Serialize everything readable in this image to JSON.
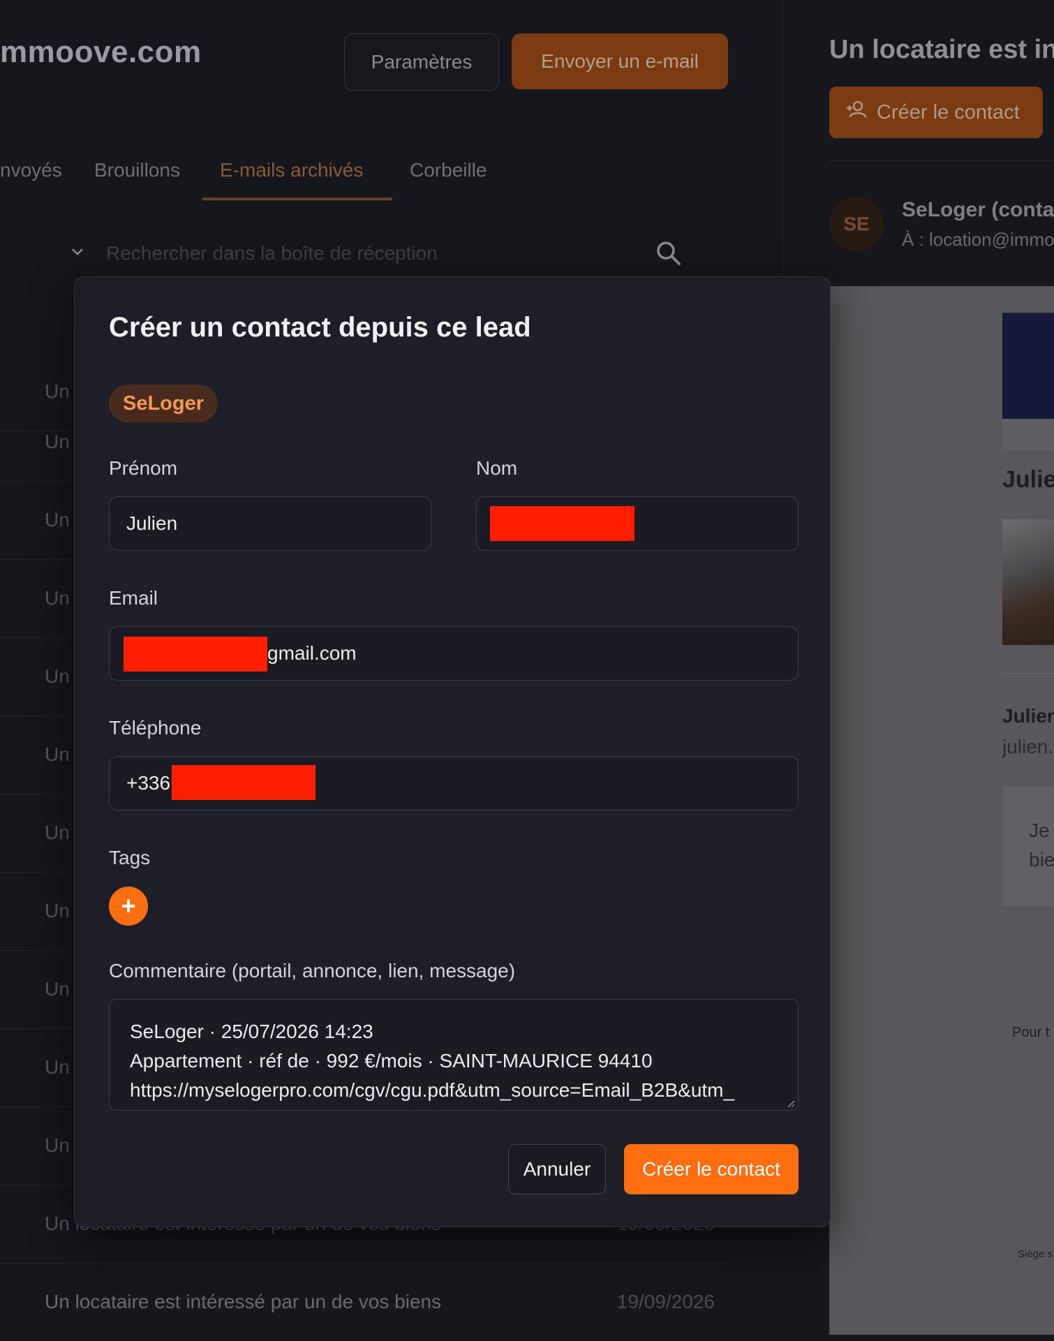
{
  "app": {
    "brand": "mmoove.com"
  },
  "header": {
    "settings_label": "Paramètres",
    "send_email_label": "Envoyer un e-mail"
  },
  "tabs": [
    {
      "label": "nvoyés",
      "active": false
    },
    {
      "label": "Brouillons",
      "active": false
    },
    {
      "label": "E-mails archivés",
      "active": true
    },
    {
      "label": "Corbeille",
      "active": false
    }
  ],
  "search": {
    "placeholder": "Rechercher dans la boîte de réception"
  },
  "mail_list": [
    {
      "subject": "Un",
      "date": ""
    },
    {
      "subject": "Un",
      "date": ""
    },
    {
      "subject": "Un",
      "date": ""
    },
    {
      "subject": "Un",
      "date": ""
    },
    {
      "subject": "Un",
      "date": ""
    },
    {
      "subject": "Un",
      "date": ""
    },
    {
      "subject": "Un",
      "date": ""
    },
    {
      "subject": "Un",
      "date": ""
    },
    {
      "subject": "Un",
      "date": ""
    },
    {
      "subject": "Un",
      "date": ""
    },
    {
      "subject": "Un",
      "date": ""
    },
    {
      "subject": "Un locataire est intéressé par un de vos biens",
      "date": "19/09/2026"
    },
    {
      "subject": "Un locataire est intéressé par un de vos biens",
      "date": "19/09/2026"
    }
  ],
  "reading_pane": {
    "title": "Un locataire est int",
    "create_contact_label": "Créer le contact",
    "avatar_initials": "SE",
    "sender": "SeLoger (contac",
    "to": "À : location@immoo",
    "body_heading": "Julie",
    "body_name": "Julien",
    "body_email": "julien.",
    "quote_line1": "Je",
    "quote_line2": "bie",
    "footer_text": "Pour t",
    "legal_text": "Siège s"
  },
  "modal": {
    "title": "Créer un contact depuis ce lead",
    "source_chip": "SeLoger",
    "first_name_label": "Prénom",
    "first_name_value": "Julien",
    "last_name_label": "Nom",
    "email_label": "Email",
    "email_value_suffix": "gmail.com",
    "phone_label": "Téléphone",
    "phone_value_prefix": "+336",
    "tags_label": "Tags",
    "add_tag_symbol": "+",
    "comment_label": "Commentaire (portail, annonce, lien, message)",
    "comment_lines": [
      "SeLoger · 25/07/2026 14:23",
      "Appartement · réf de · 992 €/mois · SAINT-MAURICE 94410",
      "https://myselogerpro.com/cgv/cgu.pdf&utm_source=Email_B2B&utm_"
    ],
    "cancel_label": "Annuler",
    "create_label": "Créer le contact"
  },
  "colors": {
    "accent": "#ff6f12",
    "redaction": "#ff1f00",
    "chip_text": "#f39a52"
  }
}
